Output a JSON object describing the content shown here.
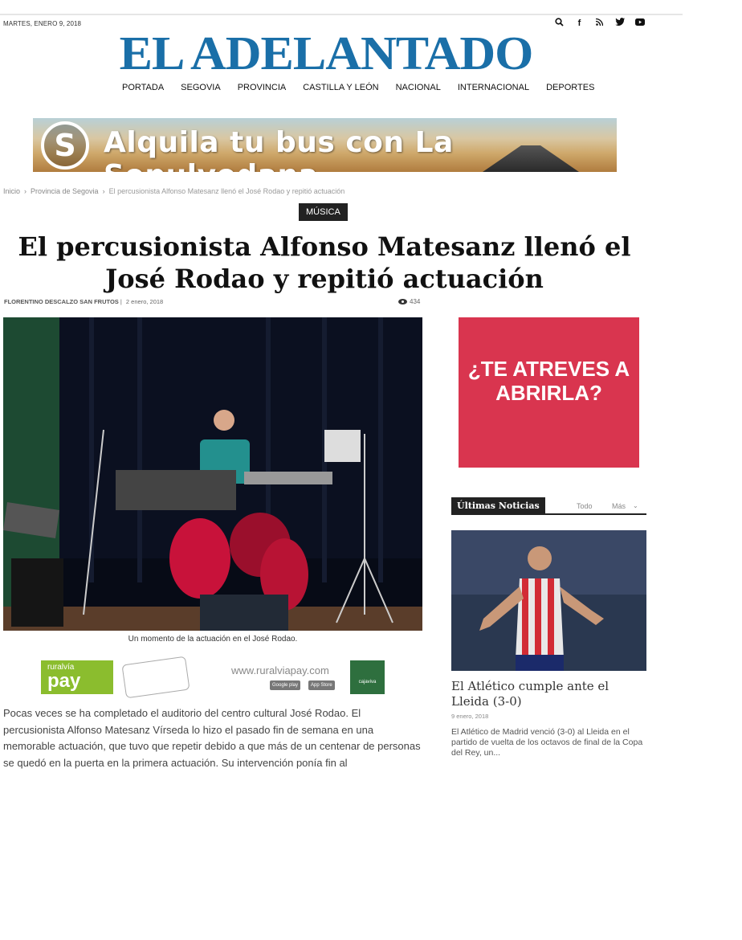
{
  "header": {
    "date": "MARTES, ENERO 9, 2018",
    "logo": "EL ADELANTADO",
    "social_icons": [
      "search-icon",
      "facebook-icon",
      "rss-icon",
      "twitter-icon",
      "youtube-icon"
    ]
  },
  "nav": {
    "items": [
      {
        "label": "PORTADA"
      },
      {
        "label": "SEGOVIA"
      },
      {
        "label": "PROVINCIA"
      },
      {
        "label": "CASTILLA Y LEÓN"
      },
      {
        "label": "NACIONAL"
      },
      {
        "label": "INTERNACIONAL"
      },
      {
        "label": "DEPORTES"
      }
    ]
  },
  "banner": {
    "text": "Alquila tu bus con La Sepulvedana"
  },
  "breadcrumb": {
    "items": [
      "Inicio",
      "Provincia de Segovia",
      "El percusionista Alfonso Matesanz llenó el José Rodao y repitió actuación"
    ],
    "separator": "›"
  },
  "article": {
    "category": "MÚSICA",
    "title": "El percusionista Alfonso Matesanz llenó el José Rodao y repitió actuación",
    "author": "FLORENTINO DESCALZO SAN FRUTOS",
    "byline_sep": "|",
    "date": "2 enero, 2018",
    "views": "434",
    "caption": "Un momento de la actuación en el José Rodao.",
    "body": "Pocas veces se ha completado el auditorio del centro cultural José Rodao. El percusionista Alfonso Matesanz Vírseda lo hizo el pasado fin de semana en una memorable actuación, que tuvo que repetir debido a que más de un centenar de personas se quedó en la puerta en la primera actuación. Su intervención ponía fin al"
  },
  "pay_ad": {
    "brand_small": "ruralvía",
    "brand_big": "pay",
    "url": "www.ruralviapay.com",
    "google_play": "Google play",
    "app_store": "App Store",
    "cajaviva": "cajaviva"
  },
  "sidebar": {
    "ad_text": "¿TE ATREVES A ABRIRLA?",
    "block_title": "Últimas Noticias",
    "tabs": [
      "Todo",
      "Más"
    ],
    "news": {
      "title": "El Atlético cumple ante el Lleida (3-0)",
      "date": "9 enero, 2018",
      "excerpt": "El Atlético de Madrid venció (3-0) al Lleida en el partido de vuelta de los octavos de final de la Copa del Rey, un..."
    }
  },
  "colors": {
    "logo": "#1a6fa8",
    "ad_red": "#d9354f",
    "category_bg": "#222222",
    "pay_green": "#8bbd2e"
  }
}
